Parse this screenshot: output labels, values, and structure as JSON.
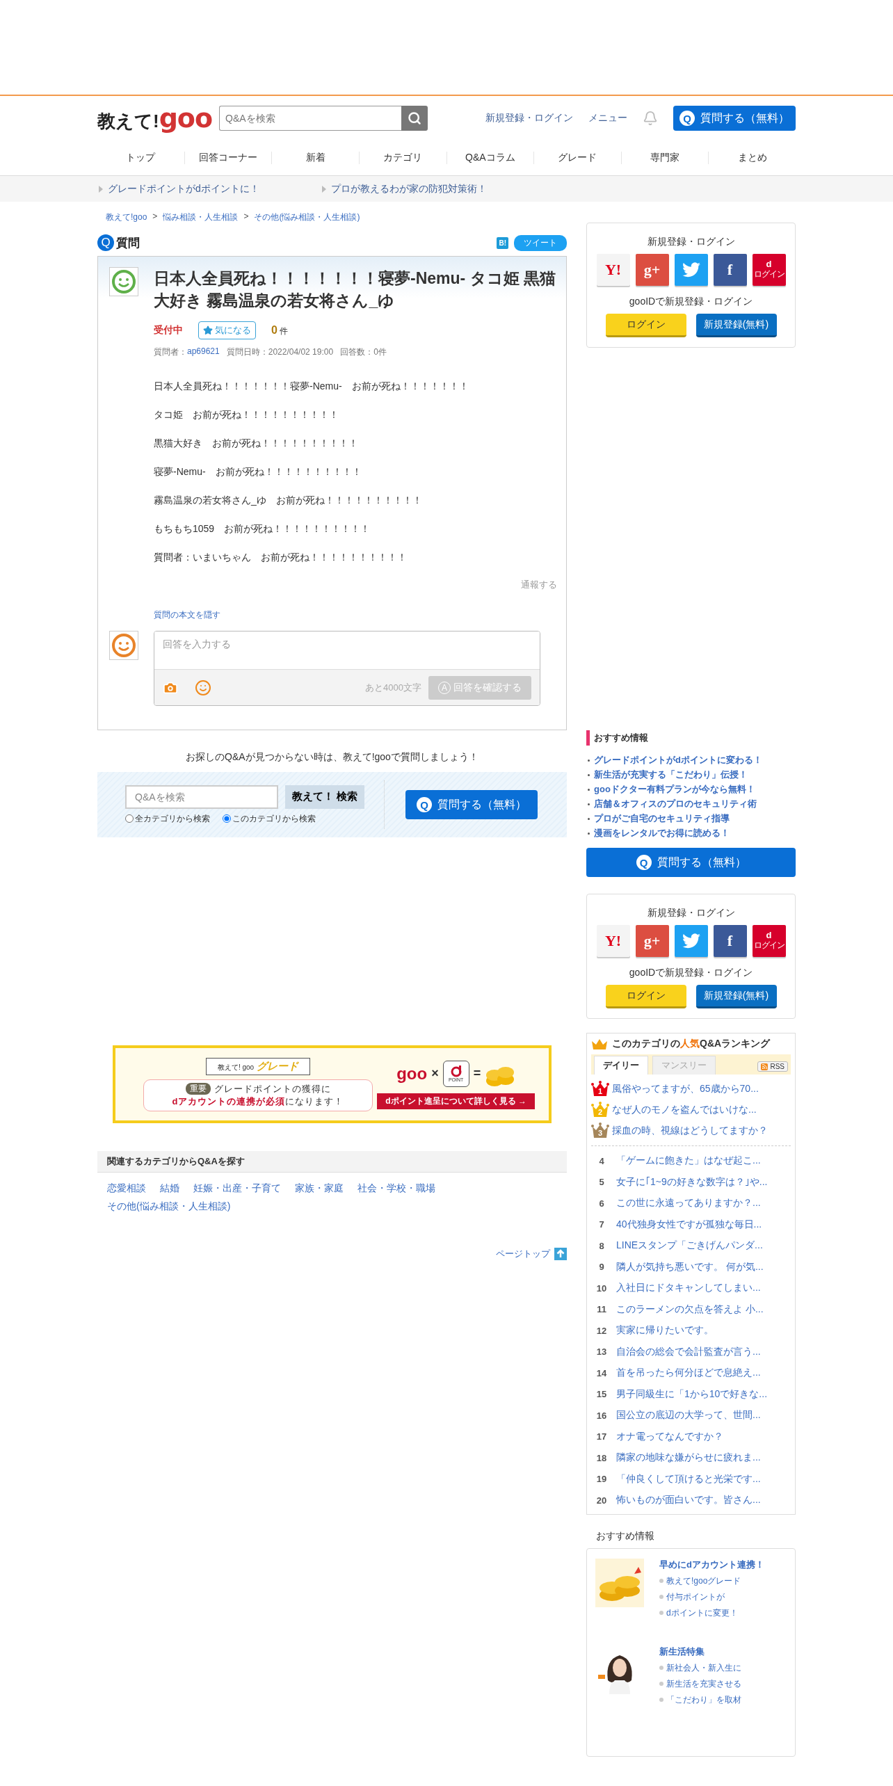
{
  "header": {
    "logo_text": "教えて!",
    "logo_brand": "goo",
    "search": {
      "placeholder": "Q&Aを検索"
    },
    "links": [
      "新規登録・ログイン",
      "メニュー"
    ],
    "ask_button": {
      "icon": "Q",
      "label": "質問する（無料）"
    }
  },
  "nav": [
    "トップ",
    "回答コーナー",
    "新着",
    "カテゴリ",
    "Q&Aコラム",
    "グレード",
    "専門家",
    "まとめ"
  ],
  "notices": [
    "グレードポイントがdポイントに！",
    "プロが教えるわが家の防犯対策術！"
  ],
  "breadcrumb": {
    "separator": ">",
    "items": [
      "教えて!goo",
      "悩み相談・人生相談",
      "その他(悩み相談・人生相談)"
    ]
  },
  "question": {
    "heading_icon": "Q",
    "heading": "質問",
    "share": [
      {
        "kind": "hatena",
        "label": "B!"
      },
      {
        "kind": "tweet",
        "label": "ツイート"
      }
    ],
    "title": "日本人全員死ね！！！！！！！寝夢-Nemu- タコ姫 黒猫大好き 霧島温泉の若女将さん_ゆ",
    "status": "受付中",
    "watch_button": "気になる",
    "watch_count": "0",
    "count_unit": "件",
    "meta": {
      "asker_label": "質問者：",
      "asker": "ap69621",
      "date": "質問日時：2022/04/02 19:00",
      "answers": "回答数：0件"
    },
    "body": [
      "日本人全員死ね！！！！！！！寝夢-Nemu-　お前が死ね！！！！！！！",
      "タコ姫　お前が死ね！！！！！！！！！！",
      "黒猫大好き　お前が死ね！！！！！！！！！！",
      "寝夢-Nemu-　お前が死ね！！！！！！！！！！",
      "霧島温泉の若女将さん_ゆ　お前が死ね！！！！！！！！！！",
      "もちもち1059　お前が死ね！！！！！！！！！！",
      "質問者：いまいちゃん　お前が死ね！！！！！！！！！！"
    ],
    "report": "通報する",
    "hide_link": "質問の本文を隠す"
  },
  "answer_form": {
    "placeholder": "回答を入力する",
    "remaining": "あと4000文字",
    "submit": {
      "icon": "A",
      "label": "回答を確認する",
      "disabled": true
    }
  },
  "search_promo": {
    "text": "お探しのQ&Aが見つからない時は、教えて!gooで質問しましょう！",
    "search": {
      "placeholder": "Q&Aを検索"
    },
    "search_button": "教えて！ 検索",
    "scopes": [
      {
        "label": "全カテゴリから検索",
        "selected": false
      },
      {
        "label": "このカテゴリから検索",
        "selected": true
      }
    ],
    "ask_button": {
      "icon": "Q",
      "label": "質問する（無料）"
    }
  },
  "banner": {
    "ribbon_prefix": "教えて! goo",
    "ribbon_title": "グレード",
    "tag": "重要",
    "line1": "グレードポイントの獲得に",
    "line2": "**dアカウントの連携が必須**になります！",
    "brand": "goo",
    "times": "×",
    "dpoint": "POINT",
    "equals": "=",
    "cta": "dポイント進呈について詳しく見る →"
  },
  "related": {
    "title": "関連するカテゴリからQ&Aを探す",
    "links": [
      "恋愛相談",
      "結婚",
      "妊娠・出産・子育て",
      "家族・家庭",
      "社会・学校・職場",
      "その他(悩み相談・人生相談)"
    ]
  },
  "page_top": "ページトップ",
  "sidebar": {
    "login_top": {
      "title": "新規登録・ログイン",
      "social": [
        {
          "kind": "yahoo",
          "label": "Y!"
        },
        {
          "kind": "google",
          "label": "g+"
        },
        {
          "kind": "twitter"
        },
        {
          "kind": "facebook",
          "label": "f"
        },
        {
          "kind": "docomo",
          "label": "d",
          "sub": "ログイン"
        }
      ],
      "goo_title": "gooIDで新規登録・ログイン",
      "login": "ログイン",
      "register": "新規登録(無料)"
    },
    "recommend": {
      "title": "おすすめ情報",
      "items": [
        "グレードポイントがdポイントに変わる！",
        "新生活が充実する「こだわり」伝授！",
        "gooドクター有料プランが今なら無料！",
        "店舗＆オフィスのプロのセキュリティ術",
        "プロがご自宅のセキュリティ指導",
        "漫画をレンタルでお得に読める！"
      ]
    },
    "ask_button": {
      "icon": "Q",
      "label": "質問する（無料）"
    },
    "login_bottom": {
      "title": "新規登録・ログイン",
      "social": [
        {
          "kind": "yahoo",
          "label": "Y!"
        },
        {
          "kind": "google",
          "label": "g+"
        },
        {
          "kind": "twitter"
        },
        {
          "kind": "facebook",
          "label": "f"
        },
        {
          "kind": "docomo",
          "label": "d",
          "sub": "ログイン"
        }
      ],
      "goo_title": "gooIDで新規登録・ログイン",
      "login": "ログイン",
      "register": "新規登録(無料)"
    },
    "ranking": {
      "title": "このカテゴリの**人気**Q&Aランキング",
      "tabs": [
        {
          "label": "デイリー",
          "selected": true
        },
        {
          "label": "マンスリー",
          "selected": false
        }
      ],
      "rss": "RSS",
      "top": [
        {
          "rank": "1",
          "color": "#e60012",
          "text": "風俗やってますが、65歳から70..."
        },
        {
          "rank": "2",
          "color": "#f2b705",
          "text": "なぜ人のモノを盗んではいけな..."
        },
        {
          "rank": "3",
          "color": "#a5865a",
          "text": "採血の時、視線はどうしてますか？"
        }
      ],
      "rest": [
        {
          "rank": "4",
          "text": "「ゲームに飽きた」はなぜ起こ..."
        },
        {
          "rank": "5",
          "text": "女子に｢1~9の好きな数字は？｣や..."
        },
        {
          "rank": "6",
          "text": "この世に永遠ってありますか？..."
        },
        {
          "rank": "7",
          "text": "40代独身女性ですが孤独な毎日..."
        },
        {
          "rank": "8",
          "text": "LINEスタンプ「ごきげんパンダ..."
        },
        {
          "rank": "9",
          "text": "隣人が気持ち悪いです。 何が気..."
        },
        {
          "rank": "10",
          "text": "入社日にドタキャンしてしまい..."
        },
        {
          "rank": "11",
          "text": "このラーメンの欠点を答えよ 小..."
        },
        {
          "rank": "12",
          "text": "実家に帰りたいです。"
        },
        {
          "rank": "13",
          "text": "自治会の総会で会計監査が言う..."
        },
        {
          "rank": "14",
          "text": "首を吊ったら何分ほどで息絶え..."
        },
        {
          "rank": "15",
          "text": "男子同級生に「1から10で好きな..."
        },
        {
          "rank": "16",
          "text": "国公立の底辺の大学って、世間..."
        },
        {
          "rank": "17",
          "text": "オナ電ってなんですか？"
        },
        {
          "rank": "18",
          "text": "隣家の地味な嫌がらせに疲れま..."
        },
        {
          "rank": "19",
          "text": "「仲良くして頂けると光栄です..."
        },
        {
          "rank": "20",
          "text": "怖いものが面白いです。皆さん..."
        }
      ]
    },
    "features": {
      "title": "おすすめ情報",
      "cards": [
        {
          "kind": "coins",
          "title": "早めにdアカウント連携！",
          "points": [
            "教えて!gooグレード",
            "付与ポイントが",
            "dポイントに変更！"
          ]
        },
        {
          "kind": "picture",
          "title": "新生活特集",
          "points": [
            "新社会人・新入生に",
            "新生活を充実させる",
            "「こだわり」を取材"
          ]
        }
      ]
    }
  }
}
